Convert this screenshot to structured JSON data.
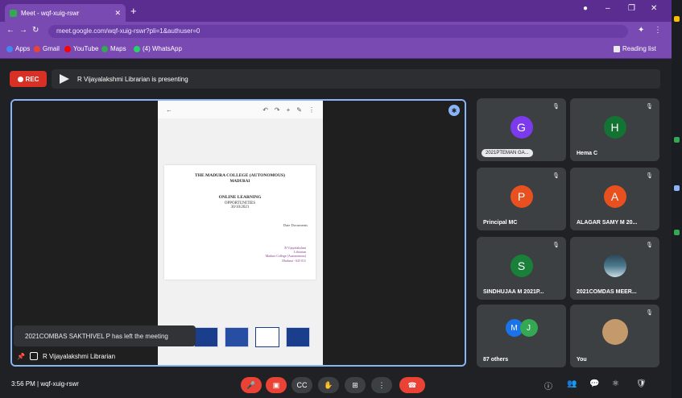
{
  "browser": {
    "tab_title": "Meet - wqf-xuig-rswr",
    "tab_close": "✕",
    "new_tab": "+",
    "window_controls": [
      "–",
      "❐",
      "✕"
    ],
    "url": "meet.google.com/wqf-xuig-rswr?pli=1&authuser=0",
    "bookmarks": [
      {
        "label": "Apps",
        "color": "#4285f4"
      },
      {
        "label": "Gmail",
        "color": "#ea4335"
      },
      {
        "label": "YouTube",
        "color": "#ff0000"
      },
      {
        "label": "Maps",
        "color": "#34a853"
      },
      {
        "label": "(4) WhatsApp",
        "color": "#25d366"
      }
    ],
    "reading_list": "Reading list"
  },
  "meet": {
    "rec_label": "REC",
    "presenting_text": "R Vijayalakshmi Librarian is presenting",
    "toast": "2021COMBAS SAKTHIVEL P has left the meeting",
    "stage_label": "R Vijayalakshmi Librarian",
    "document": {
      "heading1": "THE MADURA COLLEGE (AUTONOMOUS)",
      "heading2": "MADURAI",
      "title1": "ONLINE LEARNING",
      "title2": "OPPORTUNITIES",
      "date": "30/10/2021",
      "meta": "Date    Documents",
      "sign1": "R Vijayalakshmi",
      "sign2": "Librarian",
      "sign3": "Madura College (Autonomous)",
      "sign4": "Madurai - 625 011"
    },
    "tiles": [
      {
        "name": "2021PTEMAN GA...",
        "initial": "G",
        "color": "#7c3aed"
      },
      {
        "name": "Hema C",
        "initial": "H",
        "color": "#137333"
      },
      {
        "name": "Principal MC",
        "initial": "P",
        "color": "#e8501f"
      },
      {
        "name": "ALAGAR SAMY M 20...",
        "initial": "A",
        "color": "#e8501f"
      },
      {
        "name": "SINDHUJAA M 2021P...",
        "initial": "S",
        "color": "#188038"
      },
      {
        "name": "2021COMDAS MEER...",
        "initial": "",
        "color": "#4d7a8f"
      },
      {
        "name": "87 others",
        "initial": "M",
        "color": "#1a73e8"
      },
      {
        "name": "You",
        "initial": "",
        "color": "#c49a6c"
      }
    ],
    "clock": "3:56 PM",
    "meeting_code": "wqf-xuig-rswr"
  },
  "colors": {
    "browser_purple": "#5b2d91",
    "meet_bg": "#202124",
    "tile_bg": "#3c4043",
    "accent_blue": "#8ab4f8",
    "end_call_red": "#ea4335"
  }
}
